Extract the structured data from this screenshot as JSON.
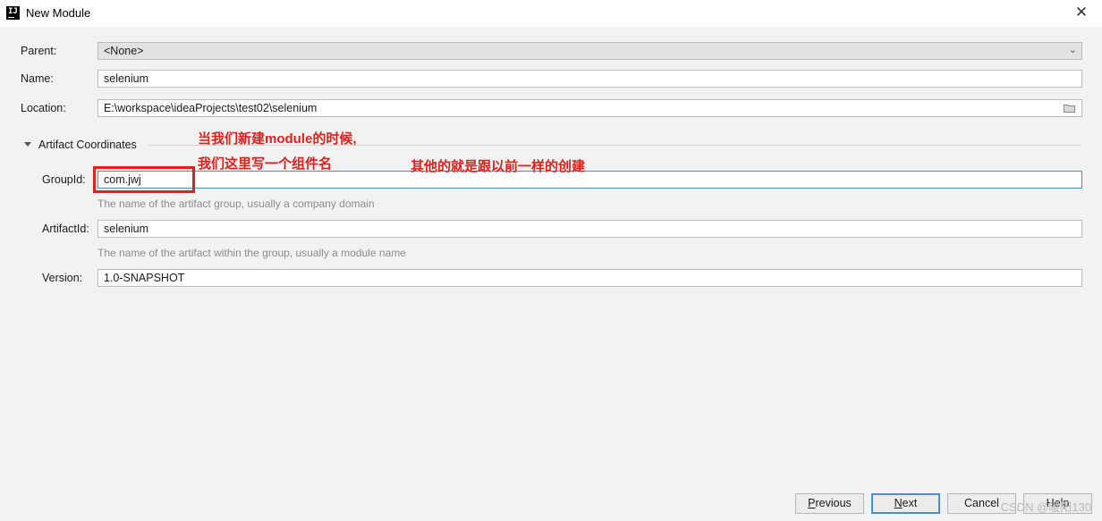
{
  "window": {
    "title": "New Module"
  },
  "form": {
    "parent_label": "Parent:",
    "parent_value": "<None>",
    "name_label": "Name:",
    "name_value": "selenium",
    "location_label": "Location:",
    "location_value": "E:\\workspace\\ideaProjects\\test02\\selenium",
    "section_title": "Artifact Coordinates",
    "groupid_label": "GroupId:",
    "groupid_value": "com.jwj",
    "groupid_hint": "The name of the artifact group, usually a company domain",
    "artifactid_label": "ArtifactId:",
    "artifactid_value": "selenium",
    "artifactid_hint": "The name of the artifact within the group, usually a module name",
    "version_label": "Version:",
    "version_value": "1.0-SNAPSHOT"
  },
  "annotations": {
    "line1": "当我们新建module的时候,",
    "line2": "我们这里写一个组件名",
    "line3": "其他的就是跟以前一样的创建"
  },
  "buttons": {
    "previous_first": "P",
    "previous_rest": "revious",
    "next_first": "N",
    "next_rest": "ext",
    "cancel": "Cancel",
    "help": "Help"
  },
  "watermark": "CSDN @暖阳130",
  "colors": {
    "accent": "#4a8bd6",
    "annotation": "#e0201b"
  },
  "icons": [
    "app-icon",
    "close-icon",
    "chevron-down-icon",
    "folder-icon",
    "collapse-arrow-icon"
  ]
}
